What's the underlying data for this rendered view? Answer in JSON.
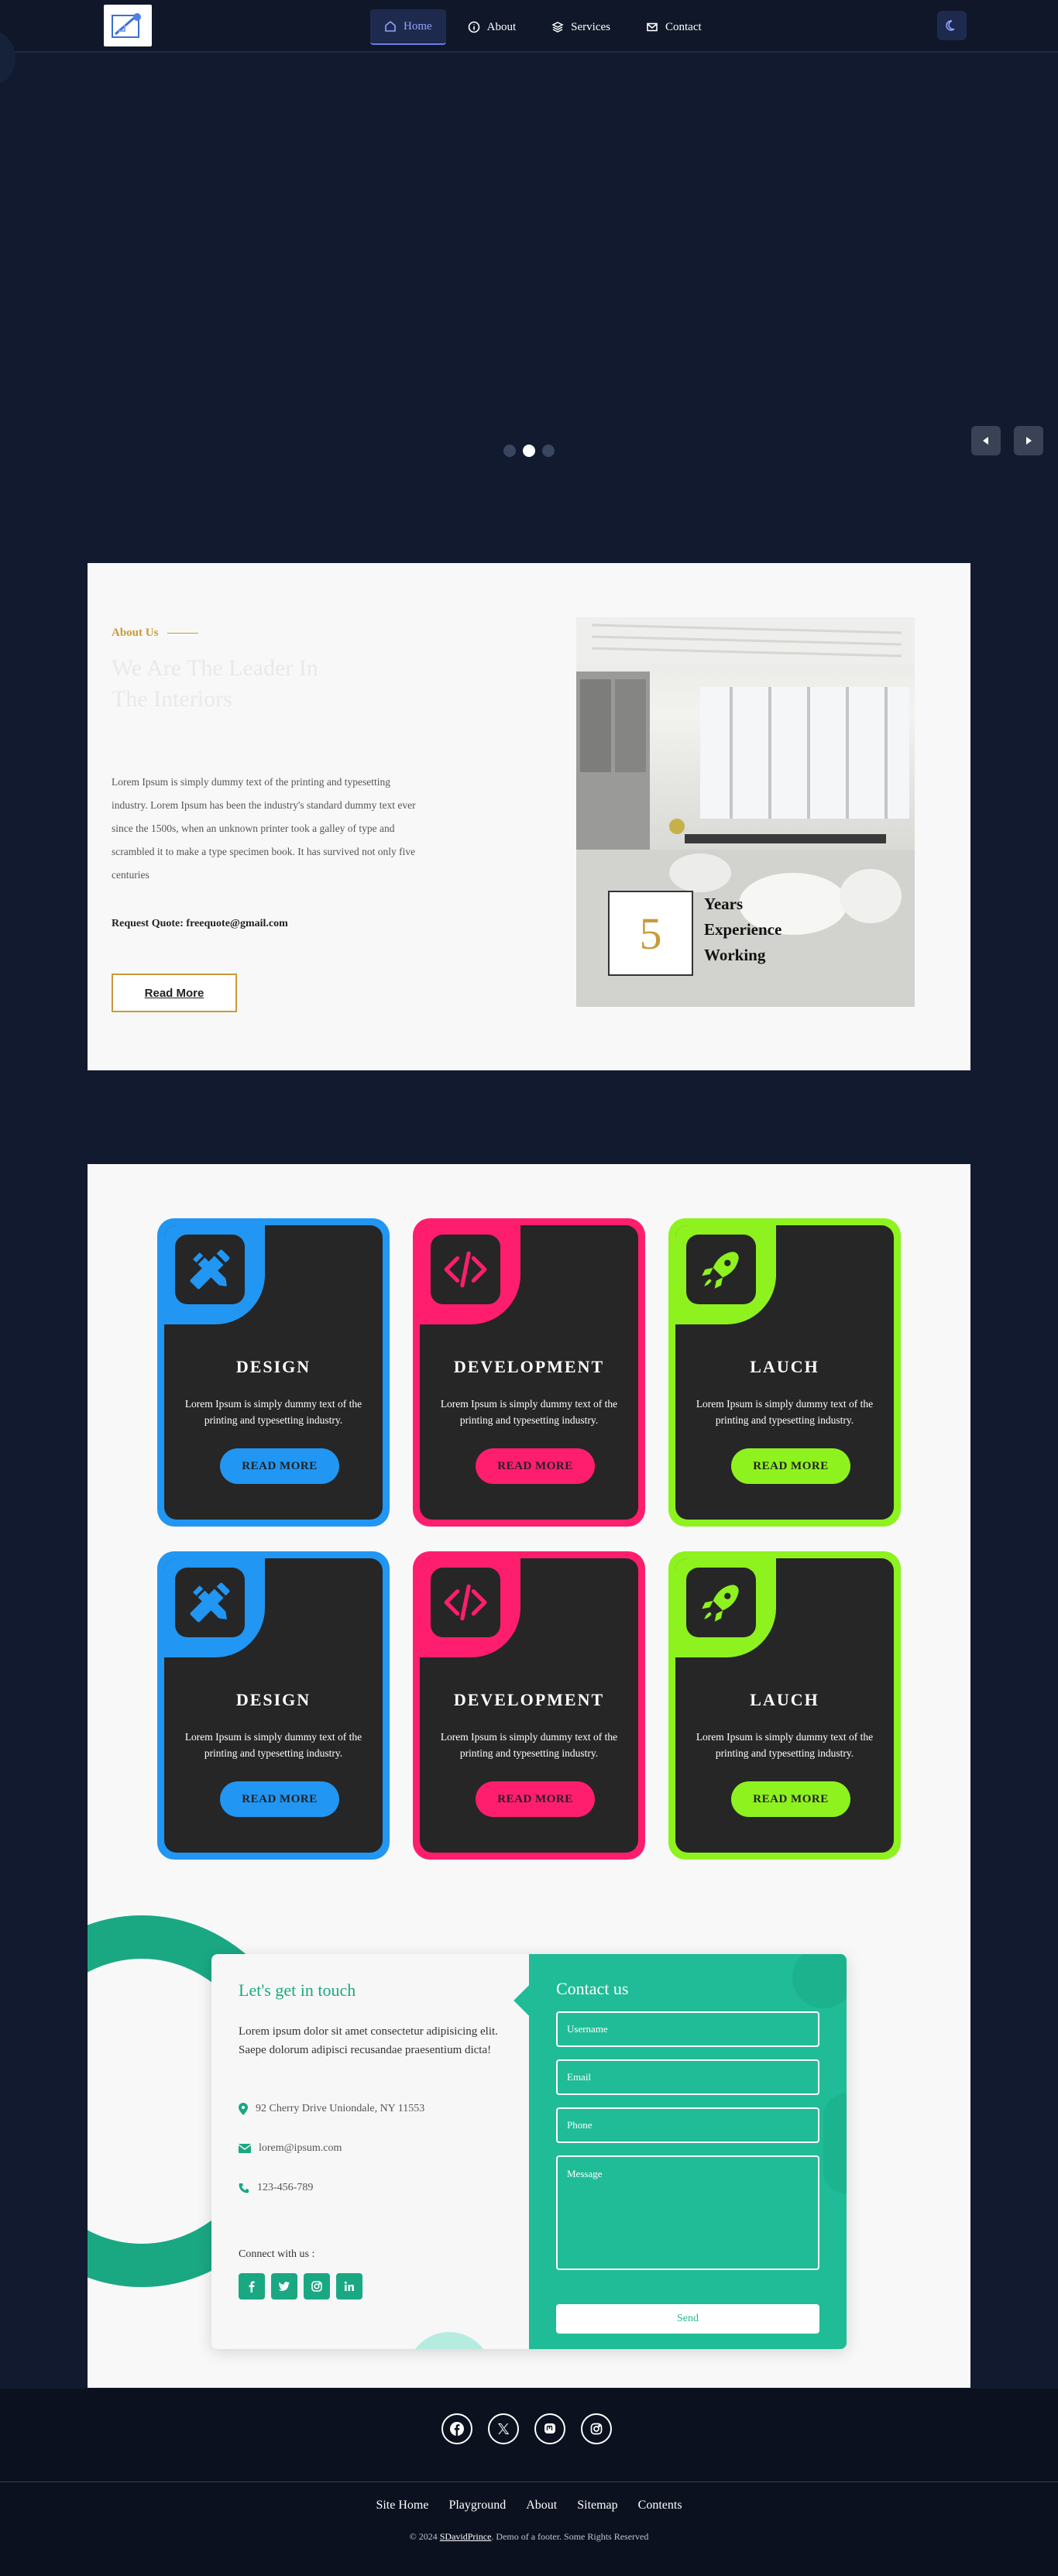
{
  "nav": {
    "links": [
      {
        "label": "Home",
        "icon": "home-icon",
        "active": true
      },
      {
        "label": "About",
        "icon": "info-icon"
      },
      {
        "label": "Services",
        "icon": "layers-icon"
      },
      {
        "label": "Contact",
        "icon": "mail-icon"
      }
    ],
    "theme_icon": "moon-icon"
  },
  "hero": {
    "slides": 3,
    "active_slide": 2
  },
  "about": {
    "kicker": "About Us",
    "title": "We Are The Leader In The Interiors",
    "text": "Lorem Ipsum is simply dummy text of the printing and typesetting industry. Lorem Ipsum has been the industry's standard dummy text ever since the 1500s, when an unknown printer took a galley of type and scrambled it to make a type specimen book. It has survived not only five centuries",
    "quote": "Request Quote: freequote@gmail.com",
    "read_more": "Read More",
    "exp_number": "5",
    "exp_line1": "Years",
    "exp_line2": "Experience",
    "exp_line3": "Working"
  },
  "services": {
    "cards": [
      {
        "title": "DESIGN",
        "text": "Lorem Ipsum is simply dummy text of the printing and typesetting industry.",
        "button": "READ MORE",
        "color": "#2196f3",
        "icon": "pencil-ruler-icon"
      },
      {
        "title": "DEVELOPMENT",
        "text": "Lorem Ipsum is simply dummy text of the printing and typesetting industry.",
        "button": "READ MORE",
        "color": "#ff1e6d",
        "icon": "code-icon"
      },
      {
        "title": "LAUCH",
        "text": "Lorem Ipsum is simply dummy text of the printing and typesetting industry.",
        "button": "READ MORE",
        "color": "#8ef21e",
        "icon": "rocket-icon"
      },
      {
        "title": "DESIGN",
        "text": "Lorem Ipsum is simply dummy text of the printing and typesetting industry.",
        "button": "READ MORE",
        "color": "#2196f3",
        "icon": "pencil-ruler-icon"
      },
      {
        "title": "DEVELOPMENT",
        "text": "Lorem Ipsum is simply dummy text of the printing and typesetting industry.",
        "button": "READ MORE",
        "color": "#ff1e6d",
        "icon": "code-icon"
      },
      {
        "title": "LAUCH",
        "text": "Lorem Ipsum is simply dummy text of the printing and typesetting industry.",
        "button": "READ MORE",
        "color": "#8ef21e",
        "icon": "rocket-icon"
      }
    ]
  },
  "contact": {
    "left_title": "Let's get in touch",
    "desc": "Lorem ipsum dolor sit amet consectetur adipisicing elit. Saepe dolorum adipisci recusandae praesentium dicta!",
    "address": "92 Cherry Drive Uniondale, NY 11553",
    "email": "lorem@ipsum.com",
    "phone": "123-456-789",
    "connect": "Connect with us :",
    "right_title": "Contact us",
    "username_placeholder": "Username",
    "email_placeholder": "Email",
    "phone_placeholder": "Phone",
    "message_placeholder": "Message",
    "send": "Send"
  },
  "footer": {
    "links": [
      "Site Home",
      "Playground",
      "About",
      "Sitemap",
      "Contents"
    ],
    "copy_prefix": "© 2024 ",
    "copy_link": "SDavidPrince",
    "copy_suffix": ". Demo of a footer. Some Rights Reserved"
  },
  "colors": {
    "background": "#111a2e",
    "accent_gold": "#c99a3a",
    "teal": "#1fbc97"
  }
}
